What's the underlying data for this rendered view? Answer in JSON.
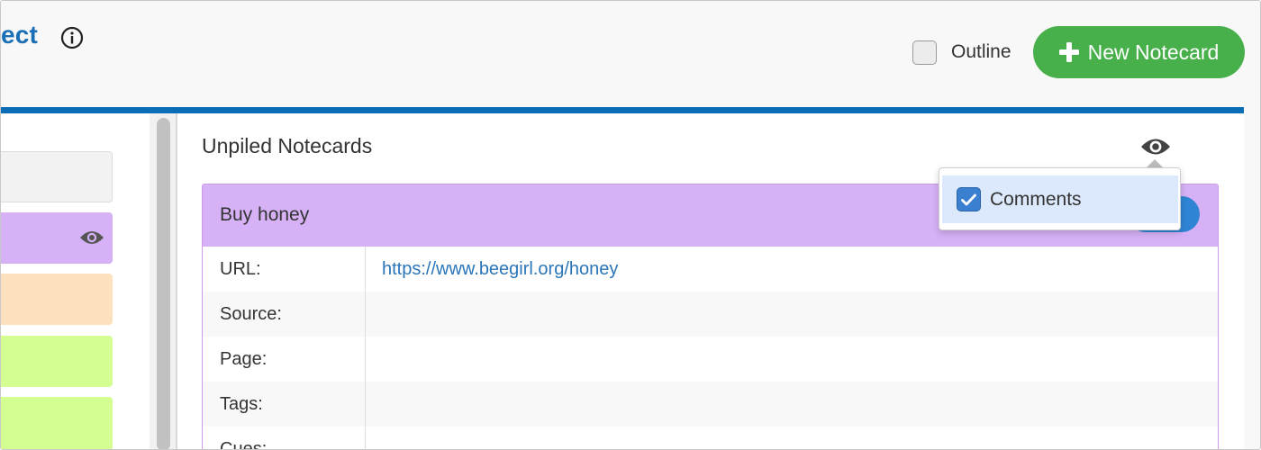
{
  "header": {
    "title_fragment": "ect",
    "outline_label": "Outline",
    "outline_checked": false,
    "new_notecard_label": "New Notecard",
    "accent": "#0b6db5",
    "new_button_color": "#47b04b"
  },
  "sidebar": {
    "piles": [
      {
        "color": "#f2f2f2"
      },
      {
        "color": "#d7b1f6",
        "icon": "eye-icon"
      },
      {
        "color": "#fde0bd"
      },
      {
        "color": "#d4fe92"
      },
      {
        "color": "#d4fe92"
      }
    ]
  },
  "main": {
    "title": "Unpiled Notecards",
    "card": {
      "title": "Buy honey",
      "header_color": "#d7b1f6",
      "rows": [
        {
          "label": "URL:",
          "value": "https://www.beegirl.org/honey"
        },
        {
          "label": "Source:",
          "value": ""
        },
        {
          "label": "Page:",
          "value": ""
        },
        {
          "label": "Tags:",
          "value": ""
        },
        {
          "label": "Cues:",
          "value": ""
        }
      ]
    },
    "visibility_menu": {
      "items": [
        {
          "label": "Comments",
          "checked": true
        }
      ]
    }
  }
}
